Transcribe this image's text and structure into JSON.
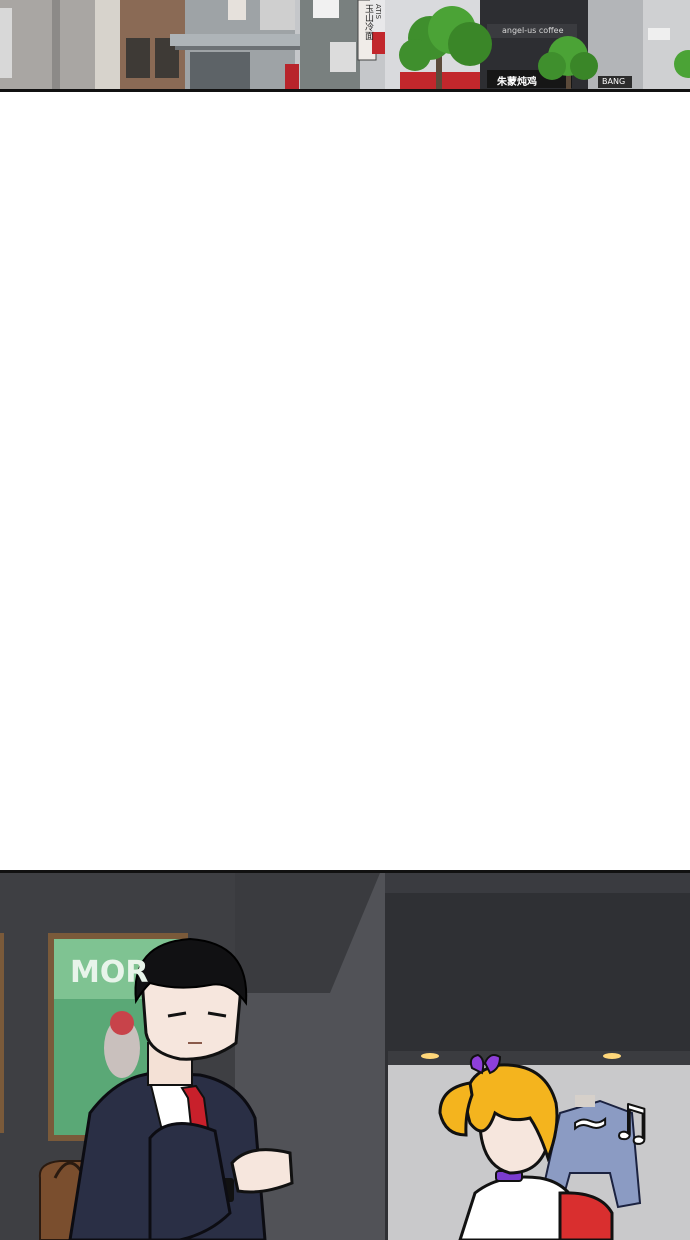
{
  "top_panel": {
    "signs": {
      "restaurant": "朱蒙炖鸡",
      "cafe": "angel-us coffee",
      "bang": "BANG",
      "vertical_sign": "玉山冷面",
      "atis": "ATIS"
    }
  },
  "bottom_panel": {
    "poster_text": "MOR",
    "music_symbol": "~♫"
  },
  "colors": {
    "panel_border": "#111111",
    "wall_dark": "#3d3e42",
    "tree_green": "#3f8f2d",
    "hair_blonde": "#f4b41e",
    "tie_red": "#c8202b"
  }
}
